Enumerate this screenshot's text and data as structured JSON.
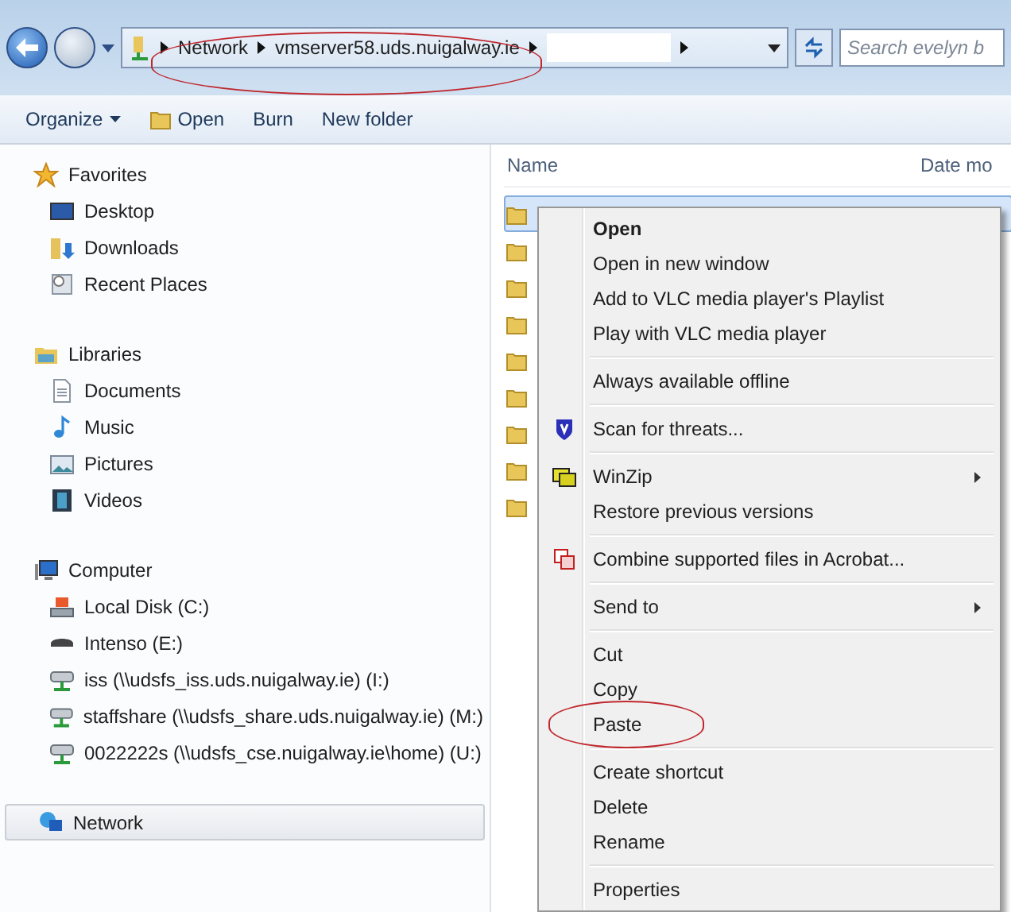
{
  "address": {
    "crumbs": [
      "Network",
      "vmserver58.uds.nuigalway.ie"
    ],
    "search": {
      "placeholder": "Search evelyn b"
    }
  },
  "toolbar": [
    {
      "label": "Organize",
      "dropdown": true
    },
    {
      "label": "Open",
      "dropdown": false
    },
    {
      "label": "Burn",
      "dropdown": false
    },
    {
      "label": "New folder",
      "dropdown": false
    }
  ],
  "sidebar": [
    {
      "label": "Favorites",
      "selected": false,
      "children": [
        {
          "label": "Desktop",
          "selected": false
        },
        {
          "label": "Downloads",
          "selected": false
        },
        {
          "label": "Recent Places",
          "selected": false
        }
      ]
    },
    {
      "label": "Libraries",
      "selected": false,
      "children": [
        {
          "label": "Documents",
          "selected": false
        },
        {
          "label": "Music",
          "selected": false
        },
        {
          "label": "Pictures",
          "selected": false
        },
        {
          "label": "Videos",
          "selected": false
        }
      ]
    },
    {
      "label": "Computer",
      "selected": false,
      "children": [
        {
          "label": "Local Disk (C:)",
          "selected": false
        },
        {
          "label": "Intenso (E:)",
          "selected": false
        },
        {
          "label": "iss (\\\\udsfs_iss.uds.nuigalway.ie) (I:)",
          "selected": false
        },
        {
          "label": "staffshare (\\\\udsfs_share.uds.nuigalway.ie) (M:)",
          "selected": false
        },
        {
          "label": "0022222s (\\\\udsfs_cse.nuigalway.ie\\home) (U:)",
          "selected": false
        }
      ]
    },
    {
      "label": "Network",
      "selected": true
    }
  ],
  "columns": [
    "Name",
    "Date mo"
  ],
  "rows": [
    {
      "selected": true
    },
    {
      "selected": false
    },
    {
      "selected": false
    },
    {
      "selected": false
    },
    {
      "selected": false
    },
    {
      "selected": false
    },
    {
      "selected": false
    },
    {
      "selected": false
    },
    {
      "selected": false
    }
  ],
  "context_menu": [
    [
      {
        "label": "Open",
        "default": true,
        "submenu": false,
        "circled": false
      },
      {
        "label": "Open in new window",
        "default": false,
        "submenu": false,
        "circled": false
      },
      {
        "label": "Add to VLC media player's Playlist",
        "default": false,
        "submenu": false,
        "circled": false
      },
      {
        "label": "Play with VLC media player",
        "default": false,
        "submenu": false,
        "circled": false
      }
    ],
    [
      {
        "label": "Always available offline",
        "default": false,
        "submenu": false,
        "circled": false
      }
    ],
    [
      {
        "label": "Scan for threats...",
        "default": false,
        "submenu": false,
        "circled": false
      }
    ],
    [
      {
        "label": "WinZip",
        "default": false,
        "submenu": true,
        "circled": false
      },
      {
        "label": "Restore previous versions",
        "default": false,
        "submenu": false,
        "circled": false
      }
    ],
    [
      {
        "label": "Combine supported files in Acrobat...",
        "default": false,
        "submenu": false,
        "circled": false
      }
    ],
    [
      {
        "label": "Send to",
        "default": false,
        "submenu": true,
        "circled": false
      }
    ],
    [
      {
        "label": "Cut",
        "default": false,
        "submenu": false,
        "circled": false
      },
      {
        "label": "Copy",
        "default": false,
        "submenu": false,
        "circled": false
      },
      {
        "label": "Paste",
        "default": false,
        "submenu": false,
        "circled": true
      }
    ],
    [
      {
        "label": "Create shortcut",
        "default": false,
        "submenu": false,
        "circled": false
      },
      {
        "label": "Delete",
        "default": false,
        "submenu": false,
        "circled": false
      },
      {
        "label": "Rename",
        "default": false,
        "submenu": false,
        "circled": false
      }
    ],
    [
      {
        "label": "Properties",
        "default": false,
        "submenu": false,
        "circled": false
      }
    ]
  ]
}
